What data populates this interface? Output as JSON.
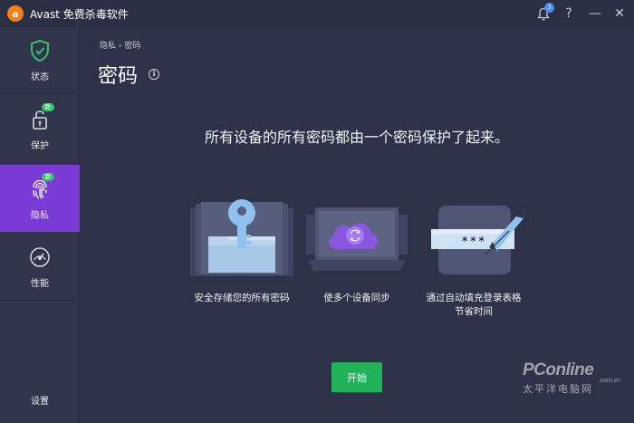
{
  "app": {
    "title": "Avast 免费杀毒软件",
    "logo_letter": "a",
    "notification_count": "3"
  },
  "titlebar": {
    "help": "?",
    "minimize": "—",
    "close": "✕"
  },
  "sidebar": {
    "items": [
      {
        "label": "状态",
        "icon": "shield-check-icon"
      },
      {
        "label": "保护",
        "icon": "lock-icon",
        "badge": "新"
      },
      {
        "label": "隐私",
        "icon": "fingerprint-icon",
        "badge": "新",
        "active": true
      },
      {
        "label": "性能",
        "icon": "speedometer-icon"
      }
    ],
    "settings_label": "设置"
  },
  "main": {
    "breadcrumb": "隐私 › 密码",
    "title": "密码",
    "headline": "所有设备的所有密码都由一个密码保护了起来。",
    "features": [
      {
        "label": "安全存储您的所有密码",
        "icon": "key-folder-icon"
      },
      {
        "label": "使多个设备同步",
        "icon": "laptop-cloud-sync-icon"
      },
      {
        "label_line1": "通过自动填充登录表格",
        "label_line2": "节省时间",
        "icon": "password-pen-icon",
        "password_mask": "***"
      }
    ],
    "start_button": "开始"
  },
  "watermark": {
    "brand": "PConline",
    "domain": ".com.cn",
    "cn": "太平洋电脑网"
  },
  "colors": {
    "active": "#7a3ad6",
    "accent_green": "#22b35a",
    "logo": "#f57d12",
    "background": "#2d3248"
  }
}
